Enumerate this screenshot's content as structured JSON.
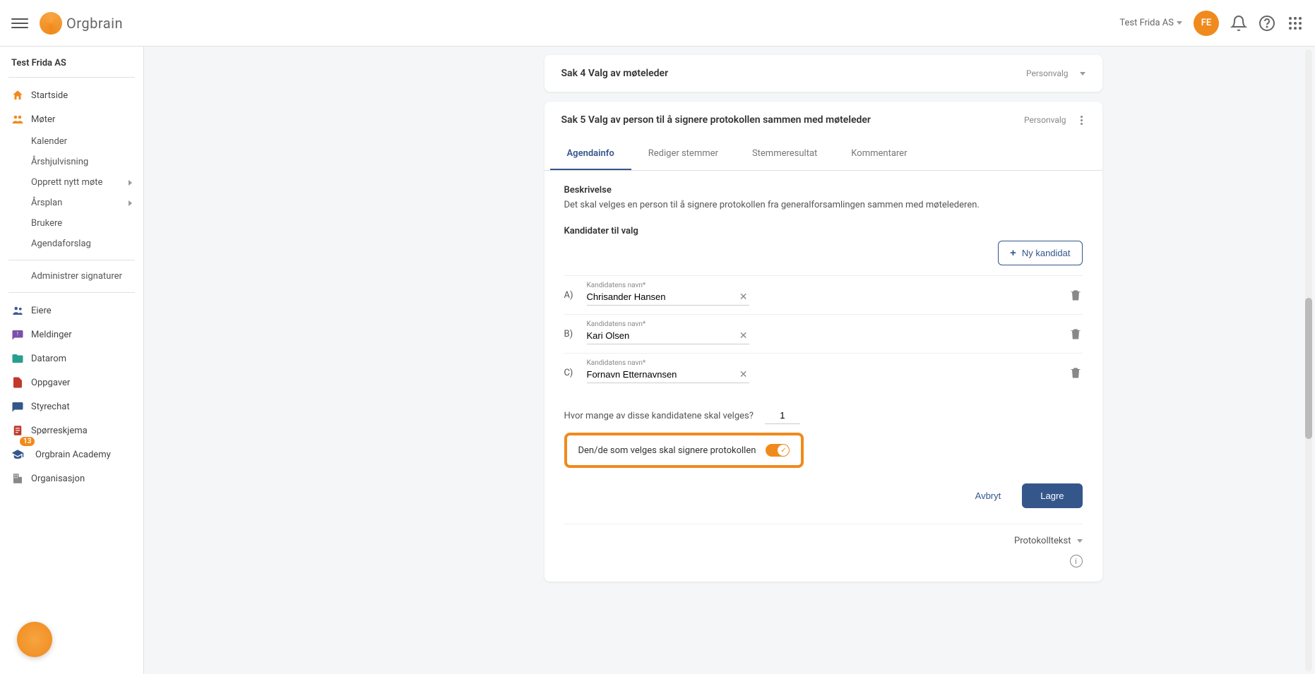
{
  "topbar": {
    "org_name": "Test Frida AS",
    "avatar_initials": "FE"
  },
  "sidebar": {
    "org_name": "Test Frida AS",
    "items": {
      "start": "Startside",
      "meetings": "Møter",
      "calendar": "Kalender",
      "yearview": "Årshjulvisning",
      "newmeeting": "Opprett nytt møte",
      "yearplan": "Årsplan",
      "users": "Brukere",
      "agenda_sugg": "Agendaforslag",
      "admin_sign": "Administrer signaturer",
      "owners": "Eiere",
      "messages": "Meldinger",
      "dataroom": "Datarom",
      "tasks": "Oppgaver",
      "styrechat": "Styrechat",
      "survey": "Spørreskjema",
      "academy": "Orgbrain Academy",
      "academy_badge": "13",
      "organisation": "Organisasjon"
    }
  },
  "sak4": {
    "title": "Sak 4 Valg av møteleder",
    "tag": "Personvalg"
  },
  "sak5": {
    "title": "Sak 5 Valg av person til å signere protokollen sammen med møteleder",
    "tag": "Personvalg",
    "tabs": {
      "agendainfo": "Agendainfo",
      "rediger": "Rediger stemmer",
      "result": "Stemmeresultat",
      "comments": "Kommentarer"
    },
    "desc_label": "Beskrivelse",
    "desc_text": "Det skal velges en person til å signere protokollen fra generalforsamlingen sammen med møtelederen.",
    "cand_label": "Kandidater til valg",
    "new_cand_btn": "Ny kandidat",
    "field_label": "Kandidatens navn*",
    "candidates": [
      {
        "letter": "A)",
        "name": "Chrisander Hansen"
      },
      {
        "letter": "B)",
        "name": "Kari Olsen"
      },
      {
        "letter": "C)",
        "name": "Fornavn Etternavnsen"
      }
    ],
    "count_label": "Hvor mange av disse kandidatene skal velges?",
    "count_value": "1",
    "toggle_label": "Den/de som velges skal signere protokollen",
    "cancel_btn": "Avbryt",
    "save_btn": "Lagre",
    "protokoll_label": "Protokolltekst"
  }
}
